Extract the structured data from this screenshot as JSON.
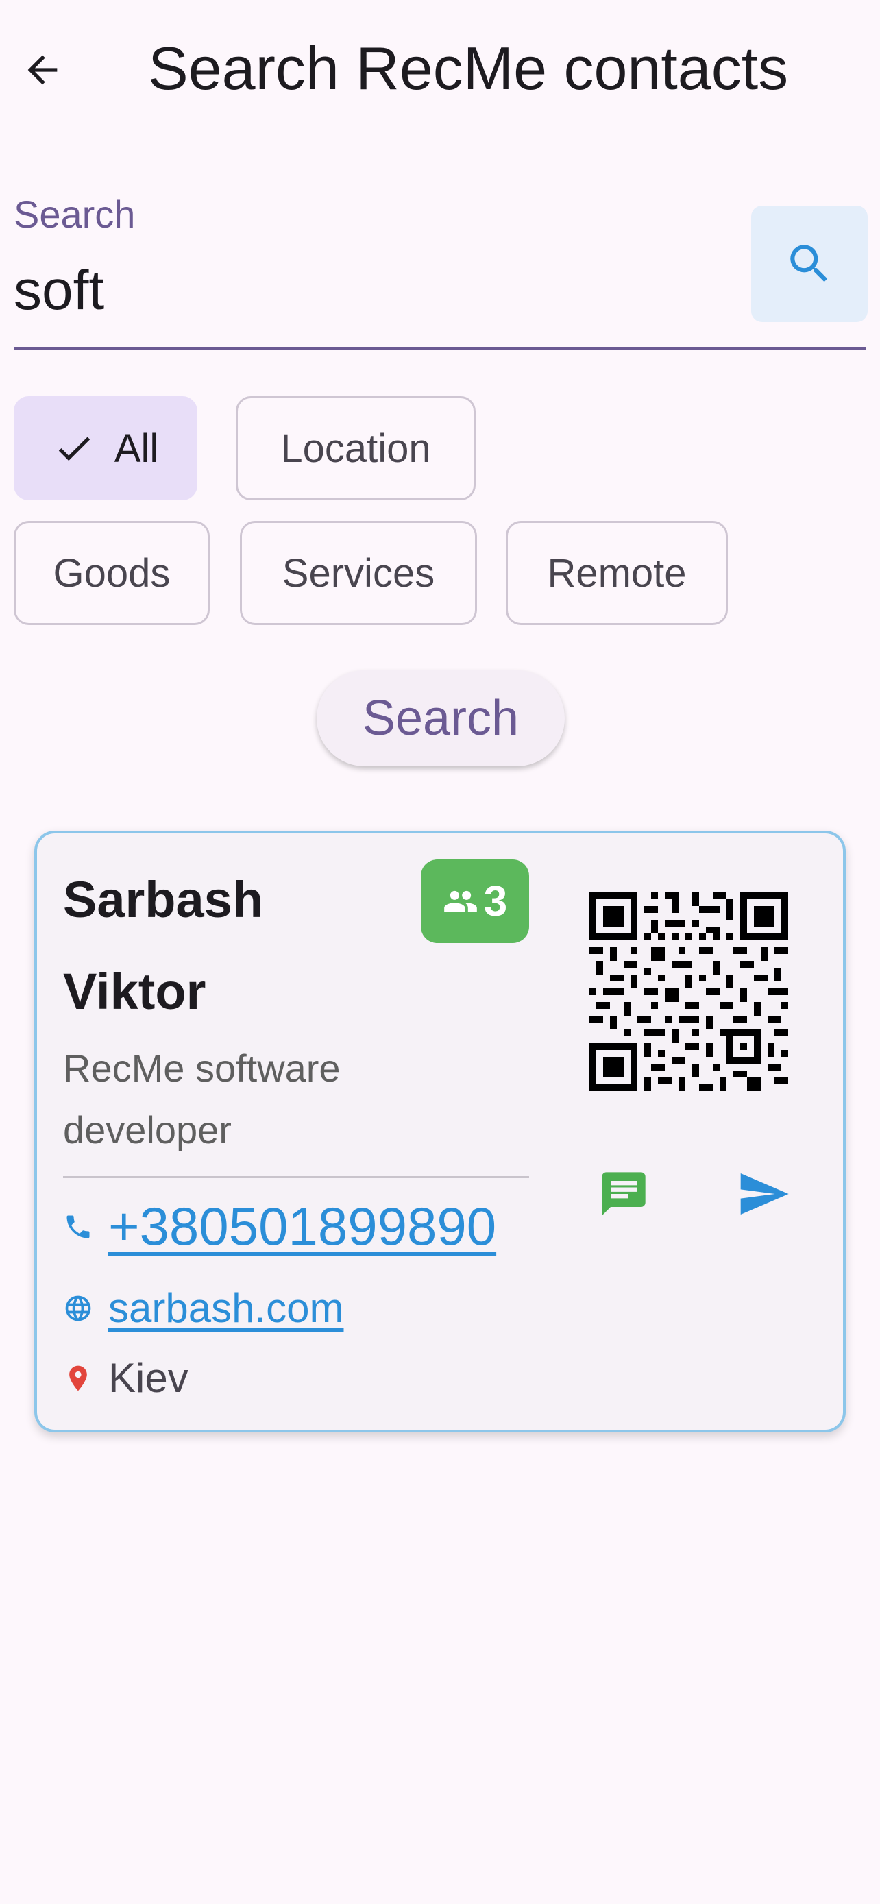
{
  "header": {
    "title": "Search RecMe contacts",
    "back_icon": "arrow-left-icon"
  },
  "search": {
    "label": "Search",
    "value": "soft",
    "submit_icon": "search-icon"
  },
  "filters": [
    {
      "label": "All",
      "selected": true
    },
    {
      "label": "Location",
      "selected": false
    },
    {
      "label": "Goods",
      "selected": false
    },
    {
      "label": "Services",
      "selected": false
    },
    {
      "label": "Remote",
      "selected": false
    }
  ],
  "search_button": {
    "label": "Search"
  },
  "results": [
    {
      "first_name": "Sarbash",
      "last_name": "Viktor",
      "contacts_count": "3",
      "title": "RecMe software developer",
      "phone": "+380501899890",
      "website": "sarbash.com",
      "city": "Kiev"
    }
  ],
  "colors": {
    "accent": "#6b5a93",
    "link": "#2b8ed8",
    "badge": "#5cb85c",
    "card_border": "#8cc6ea",
    "location_pin": "#e2453c",
    "chat": "#4caf50"
  }
}
